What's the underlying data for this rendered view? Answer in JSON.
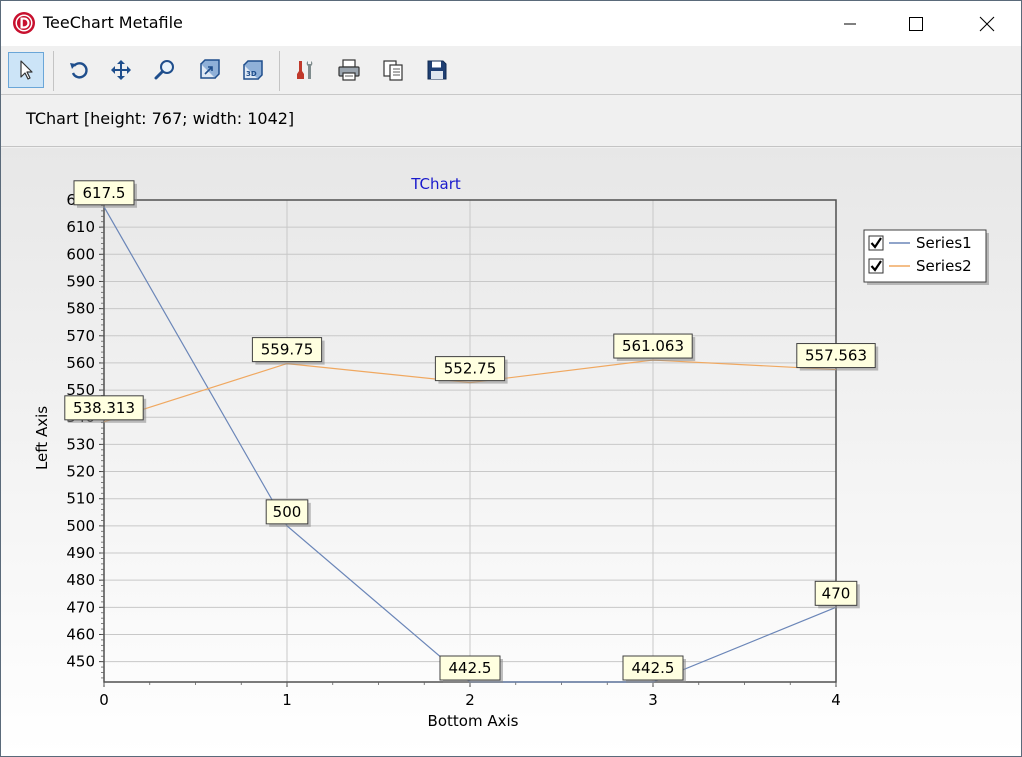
{
  "window": {
    "title": "TeeChart Metafile",
    "info_text": "TChart [height: 767; width: 1042]"
  },
  "toolbar": {
    "buttons": [
      {
        "name": "select",
        "icon": "pointer-icon"
      },
      {
        "name": "rotate",
        "icon": "rotate-icon"
      },
      {
        "name": "move",
        "icon": "move-icon"
      },
      {
        "name": "zoom",
        "icon": "zoom-icon"
      },
      {
        "name": "depth",
        "icon": "depth-icon"
      },
      {
        "name": "3d",
        "icon": "3d-icon"
      },
      {
        "name": "edit",
        "icon": "edit-tools-icon"
      },
      {
        "name": "print",
        "icon": "printer-icon"
      },
      {
        "name": "copy",
        "icon": "copy-icon"
      },
      {
        "name": "save",
        "icon": "save-icon"
      }
    ]
  },
  "colors": {
    "series1": "#6b86b8",
    "series2": "#f0a860",
    "title": "#1a1acc",
    "mark_bg": "#ffffe0"
  },
  "chart_data": {
    "type": "line",
    "title": "TChart",
    "xlabel": "Bottom Axis",
    "ylabel": "Left Axis",
    "x": [
      0,
      1,
      2,
      3,
      4
    ],
    "xlim": [
      0,
      4
    ],
    "ylim": [
      442.5,
      620
    ],
    "yticks": [
      450,
      460,
      470,
      480,
      490,
      500,
      510,
      520,
      530,
      540,
      550,
      560,
      570,
      580,
      590,
      600,
      610,
      620
    ],
    "grid": true,
    "legend_position": "top-right",
    "series": [
      {
        "name": "Series1",
        "values": [
          617.5,
          500,
          442.5,
          442.5,
          470
        ],
        "labels": [
          "617.5",
          "500",
          "442.5",
          "442.5",
          "470"
        ],
        "checked": true
      },
      {
        "name": "Series2",
        "values": [
          538.313,
          559.75,
          552.75,
          561.063,
          557.563
        ],
        "labels": [
          "538.313",
          "559.75",
          "552.75",
          "561.063",
          "557.563"
        ],
        "checked": true
      }
    ]
  }
}
